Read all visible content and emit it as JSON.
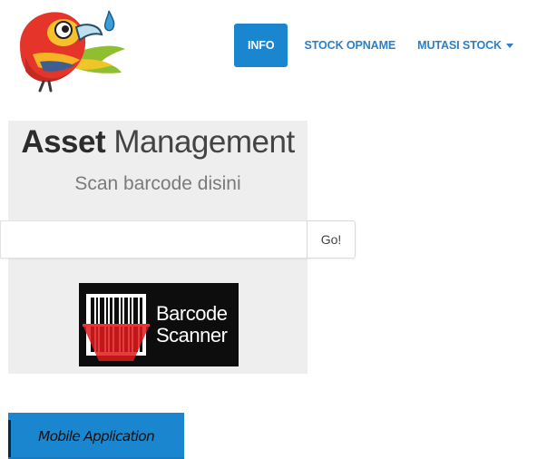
{
  "nav": {
    "items": [
      {
        "label": "INFO",
        "active": true
      },
      {
        "label": "STOCK OPNAME",
        "active": false
      },
      {
        "label": "MUTASI STOCK",
        "active": false,
        "dropdown": true
      }
    ]
  },
  "jumbotron": {
    "title_bold": "Asset",
    "title_light": "Management",
    "subtitle": "Scan barcode disini"
  },
  "search": {
    "value": "",
    "placeholder": "",
    "go_label": "Go!"
  },
  "scanner_logo": {
    "line1": "Barcode",
    "line2": "Scanner"
  },
  "mobile_button": {
    "label": "Mobile Application"
  },
  "colors": {
    "primary": "#1a86d0",
    "nav_link": "#2a7fc9",
    "panel_bg": "#eeeeee"
  },
  "icons": {
    "logo": "bird-logo-icon",
    "scanner": "barcode-scanner-icon",
    "caret": "caret-down-icon"
  }
}
